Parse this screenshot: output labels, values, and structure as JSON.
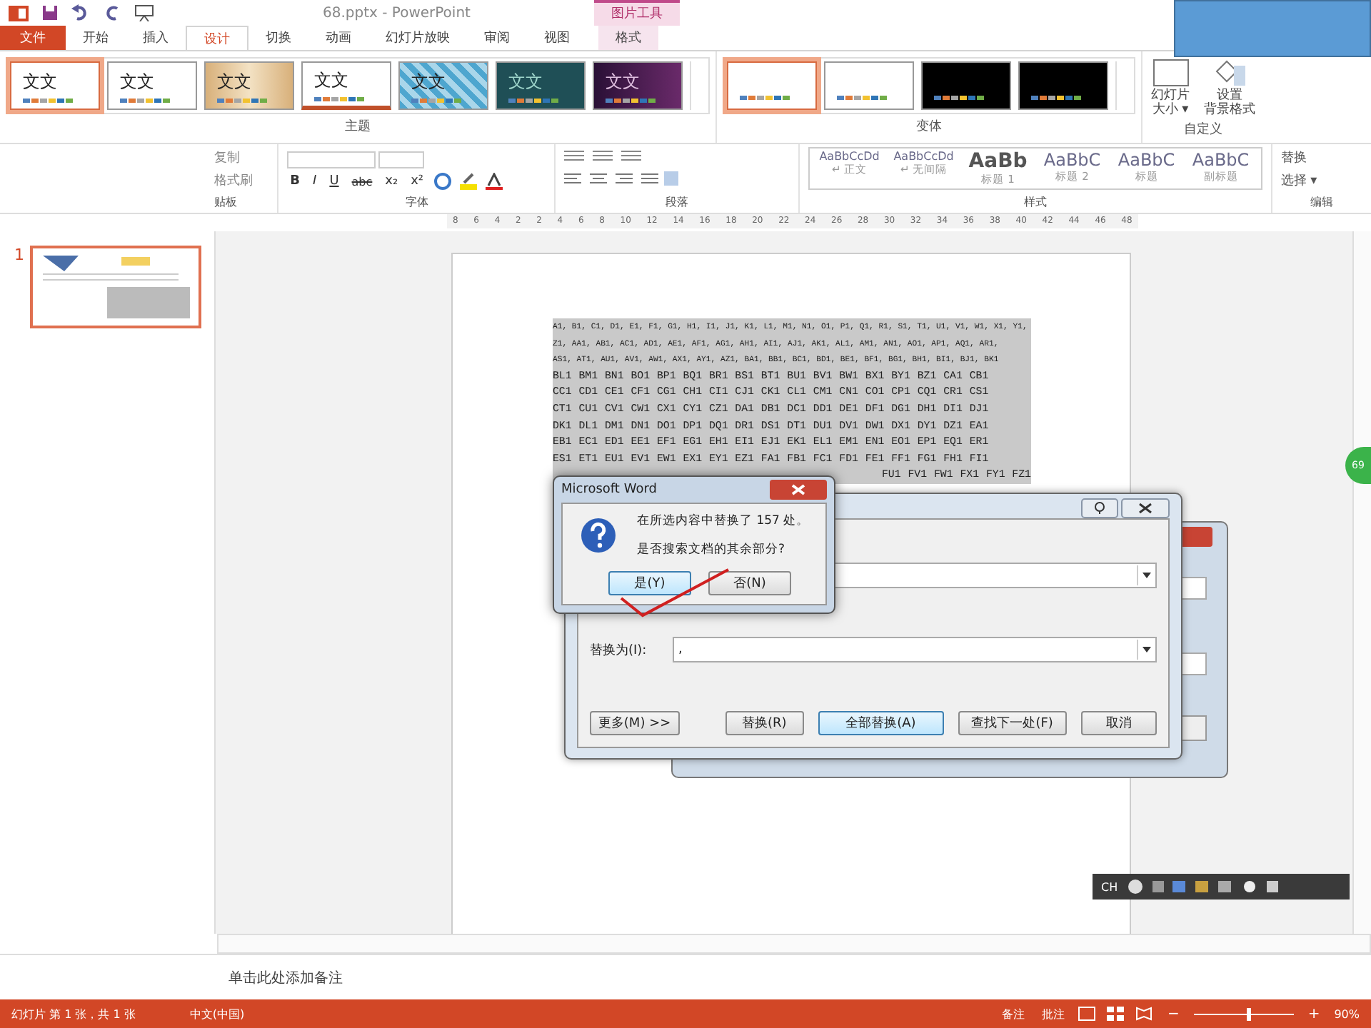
{
  "title_bar": {
    "title": "68.pptx - PowerPoint",
    "contextual_group": "图片工具"
  },
  "tabs": [
    {
      "label": "文件",
      "kind": "file",
      "selected": false
    },
    {
      "label": "开始",
      "kind": "normal",
      "selected": false
    },
    {
      "label": "插入",
      "kind": "normal",
      "selected": false
    },
    {
      "label": "设计",
      "kind": "normal",
      "selected": true
    },
    {
      "label": "切换",
      "kind": "normal",
      "selected": false
    },
    {
      "label": "动画",
      "kind": "normal",
      "selected": false
    },
    {
      "label": "幻灯片放映",
      "kind": "normal",
      "selected": false
    },
    {
      "label": "审阅",
      "kind": "normal",
      "selected": false
    },
    {
      "label": "视图",
      "kind": "normal",
      "selected": false
    },
    {
      "label": "格式",
      "kind": "contextual",
      "selected": false
    }
  ],
  "themes": {
    "label": "主题",
    "items": [
      {
        "sample": "文文",
        "kind": "office",
        "selected": true
      },
      {
        "sample": "文文",
        "kind": "office",
        "selected": false
      },
      {
        "sample": "文文",
        "kind": "wood",
        "selected": false
      },
      {
        "sample": "文文",
        "kind": "banded",
        "selected": false
      },
      {
        "sample": "文文",
        "kind": "pattern",
        "selected": false
      },
      {
        "sample": "文文",
        "kind": "teal",
        "selected": false
      },
      {
        "sample": "文文",
        "kind": "purple",
        "selected": false
      }
    ]
  },
  "variants": {
    "label": "变体",
    "items": [
      {
        "kind": "light",
        "selected": true
      },
      {
        "kind": "light",
        "selected": false
      },
      {
        "kind": "dark",
        "selected": false
      },
      {
        "kind": "dark",
        "selected": false
      }
    ]
  },
  "customize": {
    "label": "自定义",
    "buttons": [
      {
        "kind": "size",
        "lines": [
          "幻灯片",
          "大小 ▾"
        ]
      },
      {
        "kind": "background",
        "lines": [
          "设置",
          "背景格式"
        ]
      }
    ]
  },
  "word_ribbon": {
    "clipboard": {
      "items": [
        "复制",
        "格式刷"
      ],
      "label": "贴板"
    },
    "font": {
      "buttons": [
        "B",
        "I",
        "U",
        "abc",
        "x₂",
        "x²"
      ],
      "label": "字体"
    },
    "paragraph": {
      "label": "段落"
    },
    "styles": {
      "label": "样式",
      "items": [
        {
          "sample": "AaBbCcDd",
          "name": "↵ 正文",
          "kind": "body"
        },
        {
          "sample": "AaBbCcDd",
          "name": "↵ 无间隔",
          "kind": "body"
        },
        {
          "sample": "AaBb",
          "name": "标题 1",
          "kind": "heading1"
        },
        {
          "sample": "AaBbC",
          "name": "标题 2",
          "kind": "heading"
        },
        {
          "sample": "AaBbC",
          "name": "标题",
          "kind": "heading"
        },
        {
          "sample": "AaBbC",
          "name": "副标题",
          "kind": "heading"
        }
      ]
    },
    "editing": {
      "items": [
        "替换",
        "选择 ▾"
      ],
      "label": "编辑"
    }
  },
  "ruler": [
    "8",
    "6",
    "4",
    "2",
    "2",
    "4",
    "6",
    "8",
    "10",
    "12",
    "14",
    "16",
    "18",
    "20",
    "22",
    "24",
    "26",
    "28",
    "30",
    "32",
    "34",
    "36",
    "38",
    "40",
    "42",
    "44",
    "46",
    "48"
  ],
  "slides": [
    {
      "number": "1",
      "selected": true
    }
  ],
  "document_lines": [
    "A1, B1, C1, D1, E1, F1, G1, H1, I1, J1, K1, L1, M1, N1, O1, P1, Q1, R1, S1, T1, U1, V1, W1, X1, Y1,",
    "Z1, AA1, AB1, AC1, AD1, AE1, AF1, AG1, AH1, AI1, AJ1, AK1, AL1, AM1, AN1, AO1, AP1, AQ1, AR1,",
    "AS1, AT1, AU1, AV1, AW1, AX1, AY1, AZ1, BA1, BB1, BC1, BD1, BE1, BF1, BG1, BH1, BI1, BJ1, BK1",
    "BL1 BM1 BN1 BO1 BP1 BQ1 BR1 BS1 BT1 BU1 BV1 BW1 BX1 BY1 BZ1 CA1 CB1",
    "CC1 CD1 CE1 CF1 CG1 CH1 CI1 CJ1 CK1 CL1 CM1 CN1 CO1 CP1 CQ1 CR1 CS1",
    "CT1 CU1 CV1 CW1 CX1 CY1 CZ1 DA1 DB1 DC1 DD1 DE1 DF1 DG1 DH1 DI1 DJ1",
    "DK1 DL1 DM1 DN1 DO1 DP1 DQ1 DR1 DS1 DT1 DU1 DV1 DW1 DX1 DY1 DZ1 EA1",
    "EB1 EC1 ED1 EE1 EF1 EG1 EH1 EI1 EJ1 EK1 EL1 EM1 EN1 EO1 EP1 EQ1 ER1",
    "ES1 ET1 EU1 EV1 EW1 EX1 EY1 EZ1 FA1 FB1 FC1 FD1 FE1 FF1 FG1 FH1 FI1",
    "FU1 FV1 FW1 FX1 FY1 FZ1"
  ],
  "message_box": {
    "title": "Microsoft Word",
    "lines": [
      "在所选内容中替换了 157 处。",
      "是否搜索文档的其余部分?"
    ],
    "buttons": [
      {
        "label": "是(Y)",
        "selected": true
      },
      {
        "label": "否(N)",
        "selected": false
      }
    ]
  },
  "replace_dialog": {
    "replace_label": "替换为(I):",
    "replace_value": ",",
    "buttons": [
      {
        "label": "更多(M) >>",
        "default": false
      },
      {
        "label": "替换(R)",
        "default": false
      },
      {
        "label": "全部替换(A)",
        "default": true
      },
      {
        "label": "查找下一处(F)",
        "default": false
      },
      {
        "label": "取消",
        "default": false
      }
    ]
  },
  "side_badge": "69",
  "language_bar": "CH",
  "notes_placeholder": "单击此处添加备注",
  "status_bar": {
    "slide": "幻灯片 第 1 张，共 1 张",
    "language": "中文(中国)",
    "notes": "备注",
    "comments": "批注",
    "zoom": "90%",
    "zoom_out": "−",
    "zoom_in": "+",
    "zoom_slider": {
      "level": 0.55
    }
  }
}
